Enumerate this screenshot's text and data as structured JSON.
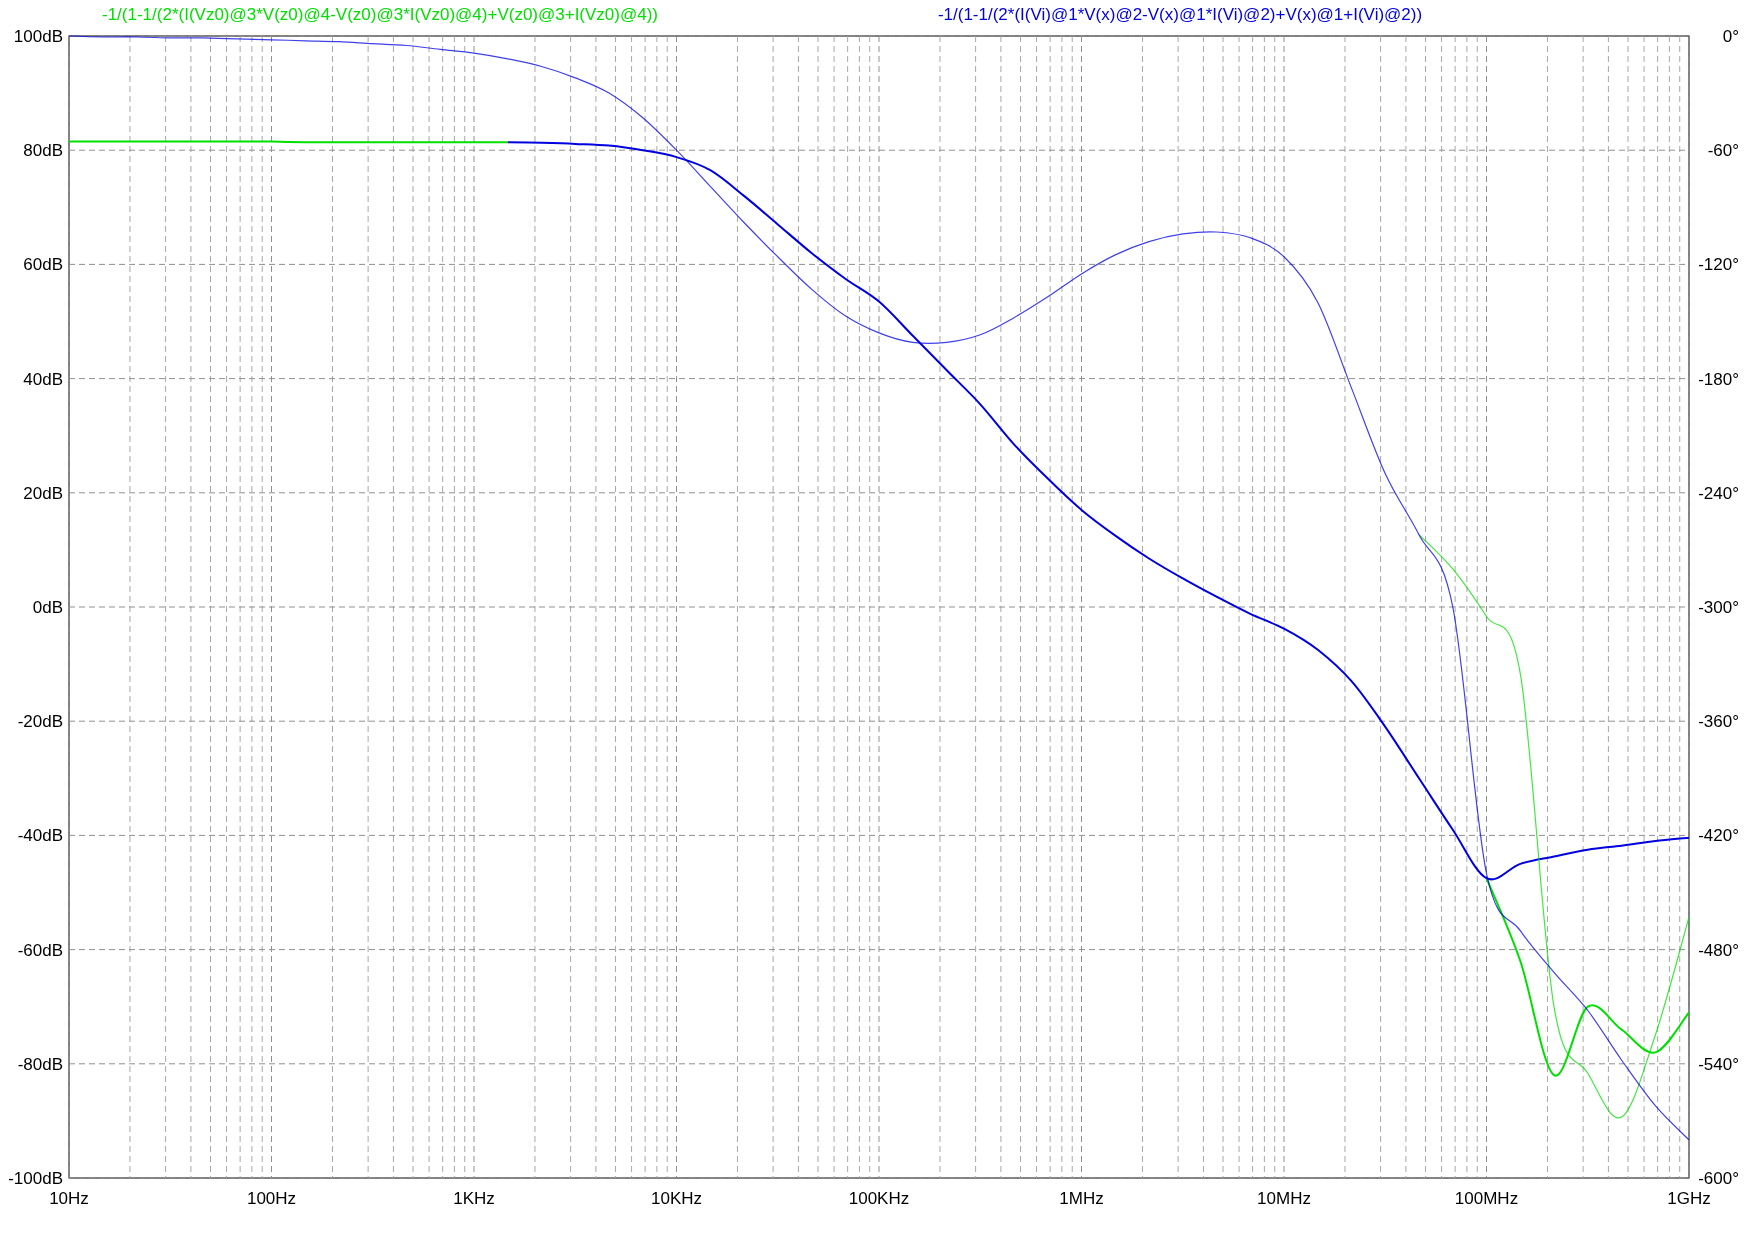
{
  "plot": {
    "chart_data": {
      "type": "line",
      "grid": true,
      "categories": [
        "10Hz",
        null,
        null,
        null,
        null,
        null,
        "100Hz",
        null,
        null,
        null,
        null,
        null,
        "1KHz",
        null,
        null,
        null,
        null,
        null,
        "10KHz",
        null,
        null,
        null,
        null,
        null,
        "100KHz",
        null,
        null,
        null,
        null,
        null,
        "1MHz",
        null,
        null,
        null,
        null,
        null,
        "10MHz",
        null,
        null,
        null,
        null,
        null,
        "100MHz",
        null,
        null,
        null,
        null,
        null,
        "1GHz"
      ],
      "ylim": [
        -100,
        100
      ],
      "y2lim": [
        -600,
        0
      ],
      "yticks": [
        {
          "value": 100,
          "label": "100dB"
        },
        {
          "value": 80,
          "label": "80dB"
        },
        {
          "value": 60,
          "label": "60dB"
        },
        {
          "value": 40,
          "label": "40dB"
        },
        {
          "value": 20,
          "label": "20dB"
        },
        {
          "value": 0,
          "label": "0dB"
        },
        {
          "value": -20,
          "label": "-20dB"
        },
        {
          "value": -40,
          "label": "-40dB"
        },
        {
          "value": -60,
          "label": "-60dB"
        },
        {
          "value": -80,
          "label": "-80dB"
        },
        {
          "value": -100,
          "label": "-100dB"
        }
      ],
      "y2ticks": [
        {
          "value": 0,
          "label": "0°"
        },
        {
          "value": -60,
          "label": "-60°"
        },
        {
          "value": -120,
          "label": "-120°"
        },
        {
          "value": -180,
          "label": "-180°"
        },
        {
          "value": -240,
          "label": "-240°"
        },
        {
          "value": -300,
          "label": "-300°"
        },
        {
          "value": -360,
          "label": "-360°"
        },
        {
          "value": -420,
          "label": "-420°"
        },
        {
          "value": -480,
          "label": "-480°"
        },
        {
          "value": -540,
          "label": "-540°"
        },
        {
          "value": -600,
          "label": "-600°"
        }
      ],
      "series": [
        {
          "name": "-1/(1-1/(2*(I(Vz0)@3*V(z0)@4-V(z0)@3*I(Vz0)@4)+V(z0)@3+I(Vz0)@4))",
          "color": "#00e000",
          "values": [
            81.5,
            81.5,
            81.5,
            81.5,
            81.5,
            81.5,
            81.5,
            81.4,
            81.4,
            81.4,
            81.4,
            81.4,
            81.4,
            81.4,
            null,
            null,
            null,
            null,
            null,
            null,
            null,
            null,
            null,
            null,
            null,
            null,
            null,
            null,
            null,
            null,
            null,
            null,
            null,
            null,
            null,
            null,
            null,
            null,
            null,
            null,
            null,
            null,
            -47.5,
            -62,
            -82,
            -70,
            -74,
            -78,
            -71
          ]
        },
        {
          "name": "-1/(1-1/(2*(I(Vi)@1*V(x)@2-V(x)@1*I(Vi)@2)+V(x)@1+I(Vi)@2))",
          "color": "#0000e0",
          "values": [
            null,
            null,
            null,
            null,
            null,
            null,
            null,
            null,
            null,
            null,
            null,
            null,
            null,
            81.4,
            81.3,
            81.1,
            80.8,
            80.0,
            78.8,
            76.5,
            72,
            67,
            62,
            57.5,
            53.5,
            47.5,
            41.5,
            35.5,
            28.5,
            22.5,
            17,
            12.5,
            8.5,
            5,
            1.8,
            -1.2,
            -3.8,
            -7.5,
            -13,
            -21,
            -30,
            -39,
            -47.5,
            -45,
            -43.7,
            -42.5,
            -41.8,
            -41,
            -40.4
          ]
        },
        {
          "color": "#00e000",
          "axis": "y2",
          "values": [
            null,
            null,
            null,
            null,
            null,
            null,
            null,
            null,
            null,
            null,
            null,
            null,
            null,
            null,
            null,
            null,
            null,
            null,
            null,
            null,
            null,
            null,
            null,
            null,
            null,
            null,
            null,
            null,
            null,
            null,
            null,
            null,
            null,
            null,
            null,
            null,
            null,
            null,
            null,
            null,
            -262,
            -280,
            -305,
            -335,
            -510,
            -545,
            -568,
            -525,
            -463
          ]
        },
        {
          "color": "#0000e0",
          "axis": "y2",
          "values": [
            0,
            -0.5,
            -0.5,
            -1,
            -1,
            -1.5,
            -2,
            -2.5,
            -3,
            -4,
            -5,
            -7,
            -9,
            -12,
            -16,
            -22,
            -30,
            -43,
            -60,
            -79,
            -98,
            -116,
            -133,
            -147,
            -156,
            -161,
            -161,
            -157,
            -148,
            -137,
            -125,
            -115,
            -108,
            -104,
            -103,
            -106,
            -116,
            -140,
            -185,
            -230,
            -262,
            -300,
            -440,
            -470,
            -492,
            -512,
            -538,
            -562,
            -580
          ]
        }
      ]
    }
  }
}
